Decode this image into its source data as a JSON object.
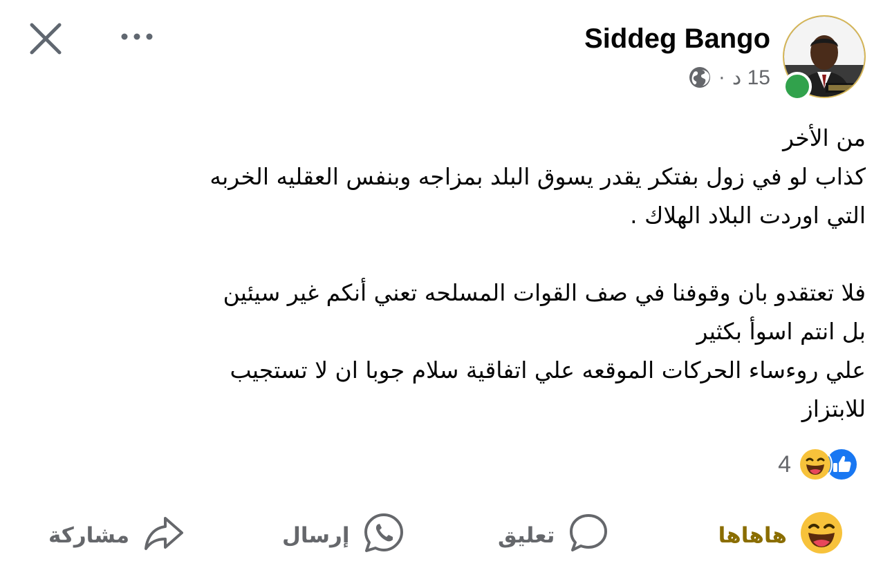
{
  "header": {
    "author": "Siddeg Bango",
    "time": "15 د",
    "separator": "·",
    "close_icon": "close-icon",
    "more_icon": "more-options-icon",
    "privacy_icon": "globe-icon"
  },
  "post": {
    "lines": [
      "من الأخر",
      "كذاب لو في زول بفتكر يقدر يسوق البلد بمزاجه وبنفس العقليه الخربه",
      "التي اوردت البلاد  الهلاك .",
      "",
      "فلا تعتقدو بان وقوفنا في صف القوات المسلحه تعني أنكم غير سيئين",
      "بل انتم اسوأ  بكثير",
      "علي روءساء الحركات الموقعه علي اتفاقية سلام جوبا ان لا تستجيب",
      "للابتزاز"
    ]
  },
  "reactions": {
    "count": "4",
    "icons": [
      "haha-icon",
      "like-icon"
    ]
  },
  "actions": {
    "haha_label": "هاهاها",
    "comment_label": "تعليق",
    "send_label": "إرسال",
    "share_label": "مشاركة"
  },
  "colors": {
    "online": "#31a24c",
    "like_blue": "#1877f2",
    "haha_yellow": "#f7c23b",
    "haha_text": "#8a6d00",
    "secondary_text": "#65676b"
  }
}
